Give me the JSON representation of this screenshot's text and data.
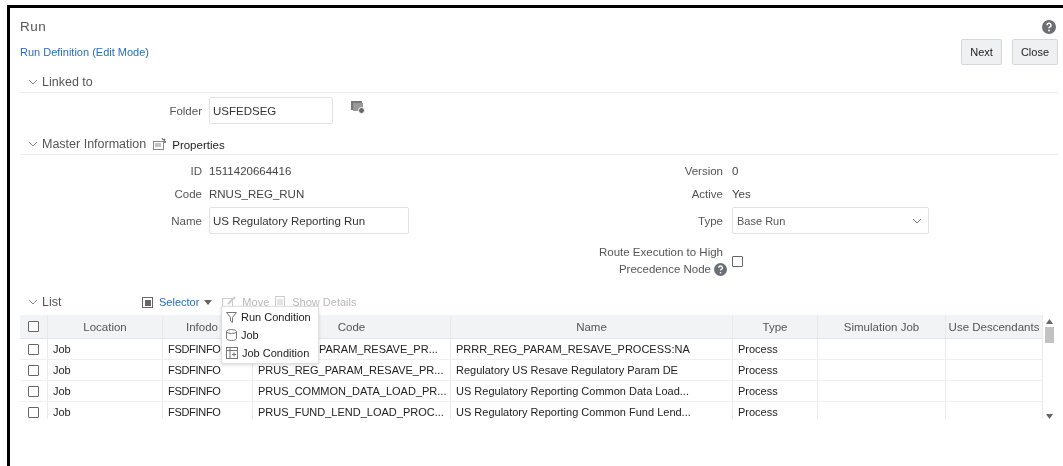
{
  "window": {
    "title": "Run"
  },
  "subtitle": "Run Definition (Edit Mode)",
  "buttons": [
    "Next",
    "Close"
  ],
  "linked_to": {
    "label": "Linked to",
    "expanded": true,
    "folder": {
      "label": "Folder",
      "value": "USFEDSEG"
    }
  },
  "master_information": {
    "label": "Master Information",
    "expanded": true,
    "properties": "Properties",
    "left_fields": [
      {
        "kind": "text",
        "label": "ID",
        "value": "1511420664416"
      },
      {
        "kind": "text",
        "label": "Code",
        "value": "RNUS_REG_RUN"
      },
      {
        "kind": "input",
        "label": "Name",
        "value": "US Regulatory Reporting Run"
      }
    ],
    "right_fields": [
      {
        "kind": "text",
        "label": "Version",
        "value": "0"
      },
      {
        "kind": "text",
        "label": "Active",
        "value": "Yes"
      },
      {
        "kind": "select",
        "label": "Type",
        "value": "Base Run"
      }
    ],
    "route_execution": {
      "label_lines": [
        "Route Execution to High",
        "Precedence Node"
      ],
      "checked": false
    }
  },
  "list": {
    "label": "List",
    "expanded": true,
    "toolbar": [
      {
        "kind": "selector",
        "label": "Selector",
        "disabled": false
      },
      {
        "kind": "edit",
        "label": "Move",
        "disabled": true
      },
      {
        "kind": "details",
        "label": "Show Details",
        "disabled": true
      }
    ],
    "menu": [
      {
        "kind": "filter",
        "label": "Run Condition"
      },
      {
        "kind": "database",
        "label": "Job"
      },
      {
        "kind": "table",
        "label": "Job Condition"
      }
    ],
    "header_checked": false,
    "columns": [
      "Location",
      "Infodo",
      "Code",
      "Name",
      "Type",
      "Simulation Job",
      "Use Descendants"
    ],
    "rows": [
      {
        "checked": false,
        "location": "Job",
        "infodom": "FSDFINFO",
        "code": "PARAM_RESAVE_PR...",
        "name": "PRRR_REG_PARAM_RESAVE_PROCESS:NA",
        "type": "Process"
      },
      {
        "checked": false,
        "location": "Job",
        "infodom": "FSDFINFO",
        "code": "PRUS_REG_PARAM_RESAVE_PR...",
        "name": "Regulatory US Resave Regulatory Param DE",
        "type": "Process"
      },
      {
        "checked": false,
        "location": "Job",
        "infodom": "FSDFINFO",
        "code": "PRUS_COMMON_DATA_LOAD_PR...",
        "name": "US Regulatory Reporting Common Data Load...",
        "type": "Process"
      },
      {
        "checked": false,
        "location": "Job",
        "infodom": "FSDFINFO",
        "code": "PRUS_FUND_LEND_LOAD_PROC...",
        "name": "US Regulatory Reporting Common Fund Lend...",
        "type": "Process"
      }
    ]
  }
}
